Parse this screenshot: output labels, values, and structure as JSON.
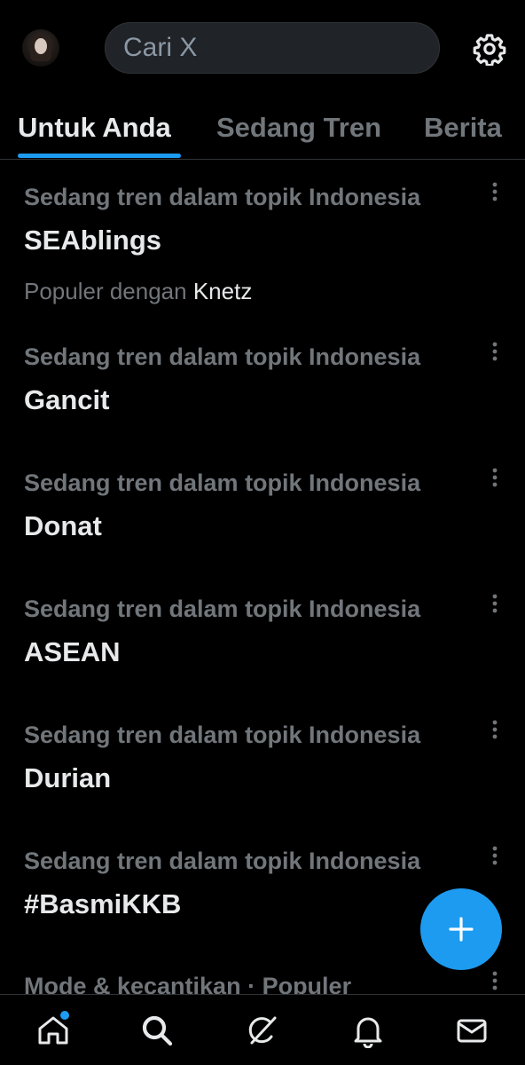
{
  "header": {
    "search_placeholder": "Cari X"
  },
  "tabs": [
    {
      "label": "Untuk Anda",
      "active": true
    },
    {
      "label": "Sedang Tren",
      "active": false
    },
    {
      "label": "Berita",
      "active": false
    }
  ],
  "trends": [
    {
      "context": "Sedang tren dalam topik Indonesia",
      "title": "SEAblings",
      "extra_prefix": "Populer dengan",
      "extra_name": "Knetz"
    },
    {
      "context": "Sedang tren dalam topik Indonesia",
      "title": "Gancit"
    },
    {
      "context": "Sedang tren dalam topik Indonesia",
      "title": "Donat"
    },
    {
      "context": "Sedang tren dalam topik Indonesia",
      "title": "ASEAN"
    },
    {
      "context": "Sedang tren dalam topik Indonesia",
      "title": "Durian"
    },
    {
      "context": "Sedang tren dalam topik Indonesia",
      "title": "#BasmiKKB"
    },
    {
      "context": "Mode & kecantikan · Populer",
      "title": ""
    }
  ],
  "colors": {
    "accent": "#1d9bf0",
    "background": "#000000",
    "text_primary": "#e7e9ea",
    "text_secondary": "#71767b"
  },
  "icons": {
    "settings": "gear-icon",
    "more": "more-vertical-icon",
    "compose": "plus-icon",
    "nav": [
      "home-icon",
      "search-icon",
      "grok-icon",
      "bell-icon",
      "mail-icon"
    ]
  }
}
